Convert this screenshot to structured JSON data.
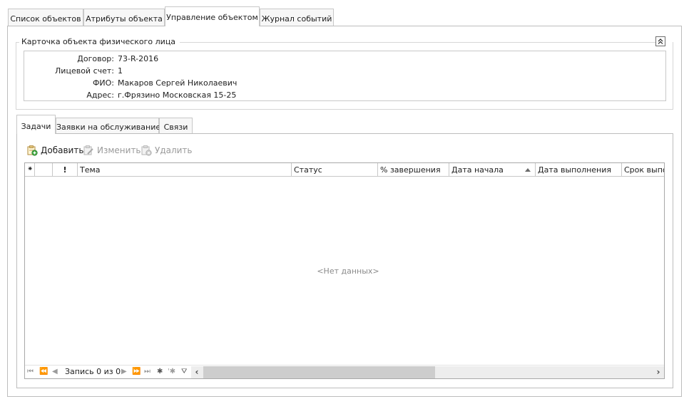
{
  "top_tabs": [
    {
      "label": "Список объектов"
    },
    {
      "label": "Атрибуты объекта"
    },
    {
      "label": "Управление объектом",
      "active": true
    },
    {
      "label": "Журнал событий"
    }
  ],
  "card": {
    "title": "Карточка объекта физического лица",
    "collapse_icon": "double-chevron-up-icon",
    "fields": [
      {
        "label": "Договор:",
        "value": "73-R-2016"
      },
      {
        "label": "Лицевой счет:",
        "value": "1"
      },
      {
        "label": "ФИО:",
        "value": "Макаров Сергей Николаевич"
      },
      {
        "label": "Адрес:",
        "value": "г.Фрязино Московская 15-25"
      }
    ]
  },
  "inner_tabs": [
    {
      "label": "Задачи",
      "active": true
    },
    {
      "label": "Заявки на обслуживание"
    },
    {
      "label": "Связи"
    }
  ],
  "toolbar": {
    "add_label": "Добавить",
    "edit_label": "Изменить",
    "delete_label": "Удалить"
  },
  "grid": {
    "header_marks": {
      "star": "⁕",
      "priority": "!"
    },
    "columns": [
      "Тема",
      "Статус",
      "% завершения",
      "Дата начала",
      "Дата выполнения",
      "Срок выпол"
    ],
    "sorted_column": "Дата начала",
    "sort_direction": "ascending",
    "empty_text": "<Нет данных>"
  },
  "navigator": {
    "record_text": "Запись 0 из 0"
  },
  "colors": {
    "border": "#bdbdbd",
    "scrollbar_track": "#e8e8e8",
    "scrollbar_thumb": "#cdcdcd",
    "disabled_text": "#9a9a9a"
  }
}
